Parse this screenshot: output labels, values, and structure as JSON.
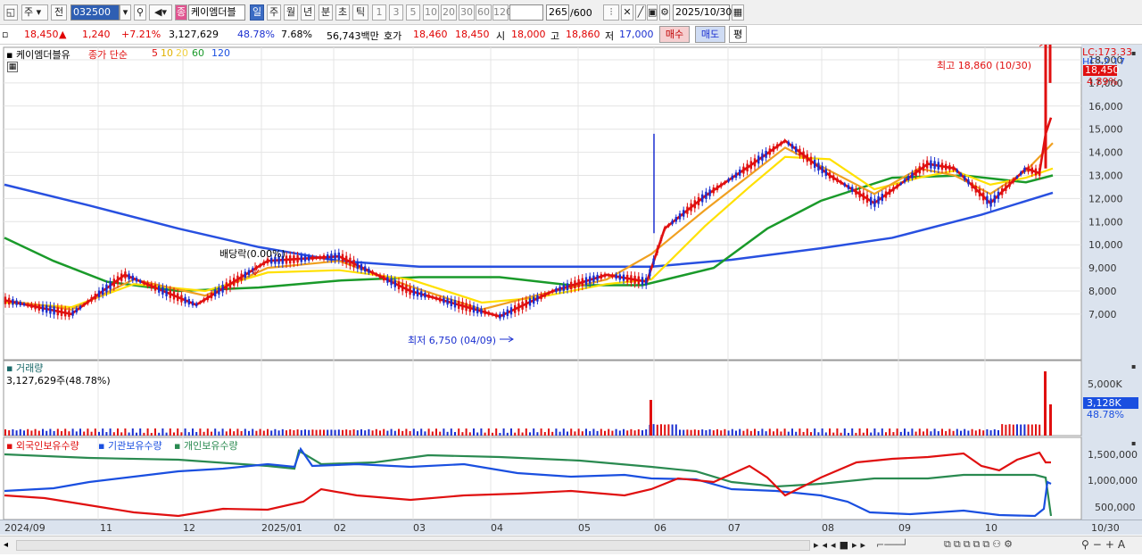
{
  "toolbar": {
    "period_main": "주",
    "type": "전",
    "code": "032500",
    "name_badge": "종",
    "name": "케이엠더블",
    "periods": [
      "일",
      "주",
      "월",
      "년",
      "분",
      "초",
      "틱"
    ],
    "intervals": [
      "1",
      "3",
      "5",
      "10",
      "20",
      "30",
      "60",
      "120"
    ],
    "count": "265",
    "count_total": "/600",
    "date": "2025/10/30"
  },
  "quote": {
    "price": "18,450",
    "change": "1,240",
    "change_pct": "+7.21%",
    "volume": "3,127,629",
    "vol_ratio": "48.78%",
    "turnover": "7.68%",
    "amount": "56,743백만",
    "ask_label": "호가",
    "ask": "18,460",
    "bid": "18,450",
    "open_label": "시",
    "open": "18,000",
    "high_label": "고",
    "high": "18,860",
    "low_label": "저",
    "low": "17,000",
    "buy": "매수",
    "sell": "매도",
    "avg": "평"
  },
  "price_panel": {
    "name": "케이엠더블유",
    "legend_label": "종가 단순",
    "ma": [
      "5",
      "10",
      "20",
      "60",
      "120"
    ],
    "ma_colors": [
      "#e01010",
      "#ffcc00",
      "#ffcc00",
      "#1a9a2a",
      "#1a4fe0"
    ],
    "right_top": "LC:173.33",
    "right_top2": "HC:-2.17",
    "last_price": "18,450",
    "last_pct": "4.89%",
    "y_ticks": [
      "18,000",
      "17,000",
      "16,000",
      "15,000",
      "14,000",
      "13,000",
      "12,000",
      "11,000",
      "10,000",
      "9,000",
      "8,000",
      "7,000"
    ],
    "annotation_high": "최고 18,860 (10/30)",
    "annotation_low": "최저 6,750 (04/09)",
    "annotation_div": "배당락(0.00%)"
  },
  "volume_panel": {
    "title": "거래량",
    "value": "3,127,629주(48.78%)",
    "y_tick": "5,000K",
    "last": "3,128K",
    "last_pct": "48.78%"
  },
  "holdings_panel": {
    "series": [
      "외국인보유수량",
      "기관보유수량",
      "개인보유수량"
    ],
    "colors": [
      "#e01010",
      "#1a4fe0",
      "#2a8a50"
    ],
    "y_ticks": [
      "1,500,000",
      "1,000,000",
      "500,000"
    ]
  },
  "x_axis": [
    "2024/09",
    "11",
    "12",
    "2025/01",
    "02",
    "03",
    "04",
    "05",
    "06",
    "07",
    "08",
    "09",
    "10",
    "10/30"
  ]
}
